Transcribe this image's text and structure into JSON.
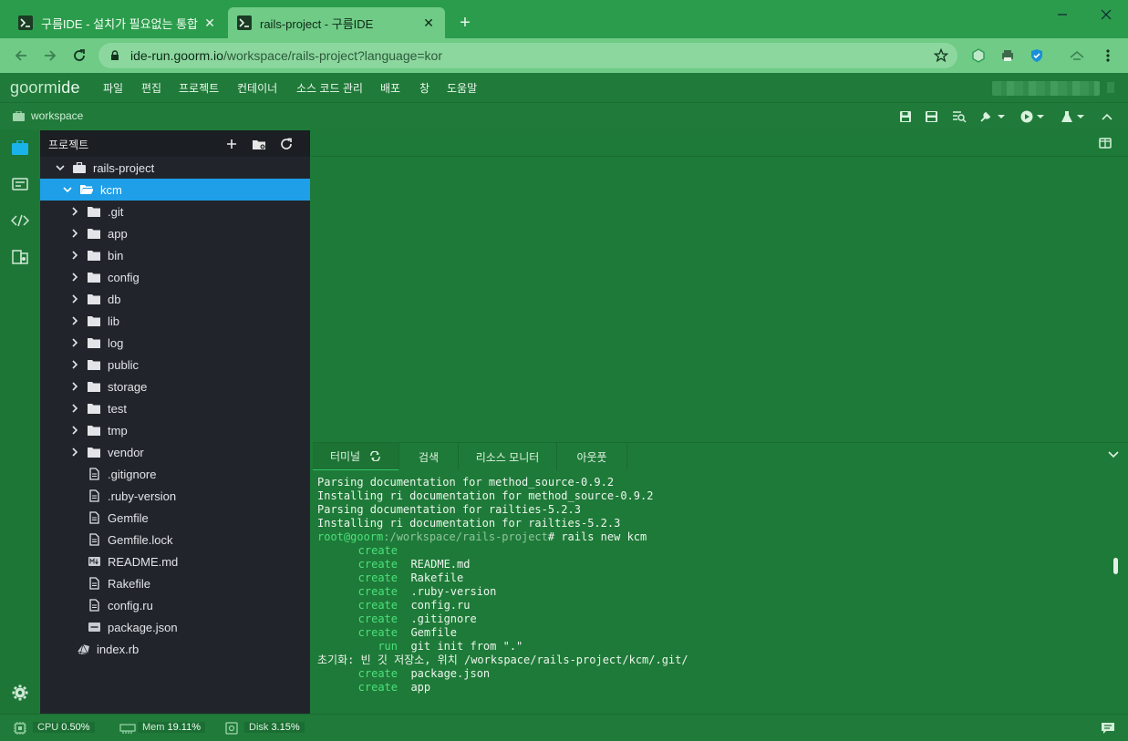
{
  "browser": {
    "tabs": [
      {
        "title": "구름IDE - 설치가 필요없는 통합"
      },
      {
        "title": "rails-project - 구름IDE"
      }
    ],
    "url_host": "ide-run.goorm.io",
    "url_path": "/workspace/rails-project?language=kor"
  },
  "ide": {
    "logo_a": "goorm",
    "logo_b": "ide",
    "menu": [
      "파일",
      "편집",
      "프로젝트",
      "컨테이너",
      "소스 코드 관리",
      "배포",
      "창",
      "도움말"
    ],
    "workspace_label": "workspace"
  },
  "explorer": {
    "title": "프로젝트",
    "items": [
      {
        "label": "rails-project",
        "kind": "root"
      },
      {
        "label": "kcm",
        "kind": "folder-open"
      },
      {
        "label": ".git",
        "kind": "folder"
      },
      {
        "label": "app",
        "kind": "folder"
      },
      {
        "label": "bin",
        "kind": "folder"
      },
      {
        "label": "config",
        "kind": "folder"
      },
      {
        "label": "db",
        "kind": "folder"
      },
      {
        "label": "lib",
        "kind": "folder"
      },
      {
        "label": "log",
        "kind": "folder"
      },
      {
        "label": "public",
        "kind": "folder"
      },
      {
        "label": "storage",
        "kind": "folder"
      },
      {
        "label": "test",
        "kind": "folder"
      },
      {
        "label": "tmp",
        "kind": "folder"
      },
      {
        "label": "vendor",
        "kind": "folder"
      },
      {
        "label": ".gitignore",
        "kind": "file"
      },
      {
        "label": ".ruby-version",
        "kind": "file"
      },
      {
        "label": "Gemfile",
        "kind": "file"
      },
      {
        "label": "Gemfile.lock",
        "kind": "file"
      },
      {
        "label": "README.md",
        "kind": "md"
      },
      {
        "label": "Rakefile",
        "kind": "file"
      },
      {
        "label": "config.ru",
        "kind": "file"
      },
      {
        "label": "package.json",
        "kind": "json"
      },
      {
        "label": "index.rb",
        "kind": "ruby"
      }
    ]
  },
  "panel": {
    "tabs": [
      "터미널",
      "검색",
      "리소스 모니터",
      "아웃풋"
    ]
  },
  "terminal": {
    "lines": [
      "Parsing documentation for method_source-0.9.2",
      "Installing ri documentation for method_source-0.9.2",
      "Parsing documentation for railties-5.2.3",
      "Installing ri documentation for railties-5.2.3"
    ],
    "prompt_user": "root@goorm",
    "prompt_path": ":/workspace/rails-project",
    "prompt_cmd": "# rails new kcm",
    "actions": [
      {
        "verb": "create",
        "arg": ""
      },
      {
        "verb": "create",
        "arg": "README.md"
      },
      {
        "verb": "create",
        "arg": "Rakefile"
      },
      {
        "verb": "create",
        "arg": ".ruby-version"
      },
      {
        "verb": "create",
        "arg": "config.ru"
      },
      {
        "verb": "create",
        "arg": ".gitignore"
      },
      {
        "verb": "create",
        "arg": "Gemfile"
      },
      {
        "verb": "run",
        "arg": "git init from \".\""
      }
    ],
    "init_line": "초기화: 빈 깃 저장소, 위치 /workspace/rails-project/kcm/.git/",
    "actions2": [
      {
        "verb": "create",
        "arg": "package.json"
      },
      {
        "verb": "create",
        "arg": "app"
      }
    ]
  },
  "status": {
    "cpu_label": "CPU",
    "cpu_value": "0.50%",
    "mem_label": "Mem",
    "mem_value": "19.11%",
    "disk_label": "Disk",
    "disk_value": "3.15%"
  },
  "colors": {
    "accent": "#1e9fe8",
    "ide_green": "#1e7a38",
    "terminal_green": "#4ce07c"
  }
}
